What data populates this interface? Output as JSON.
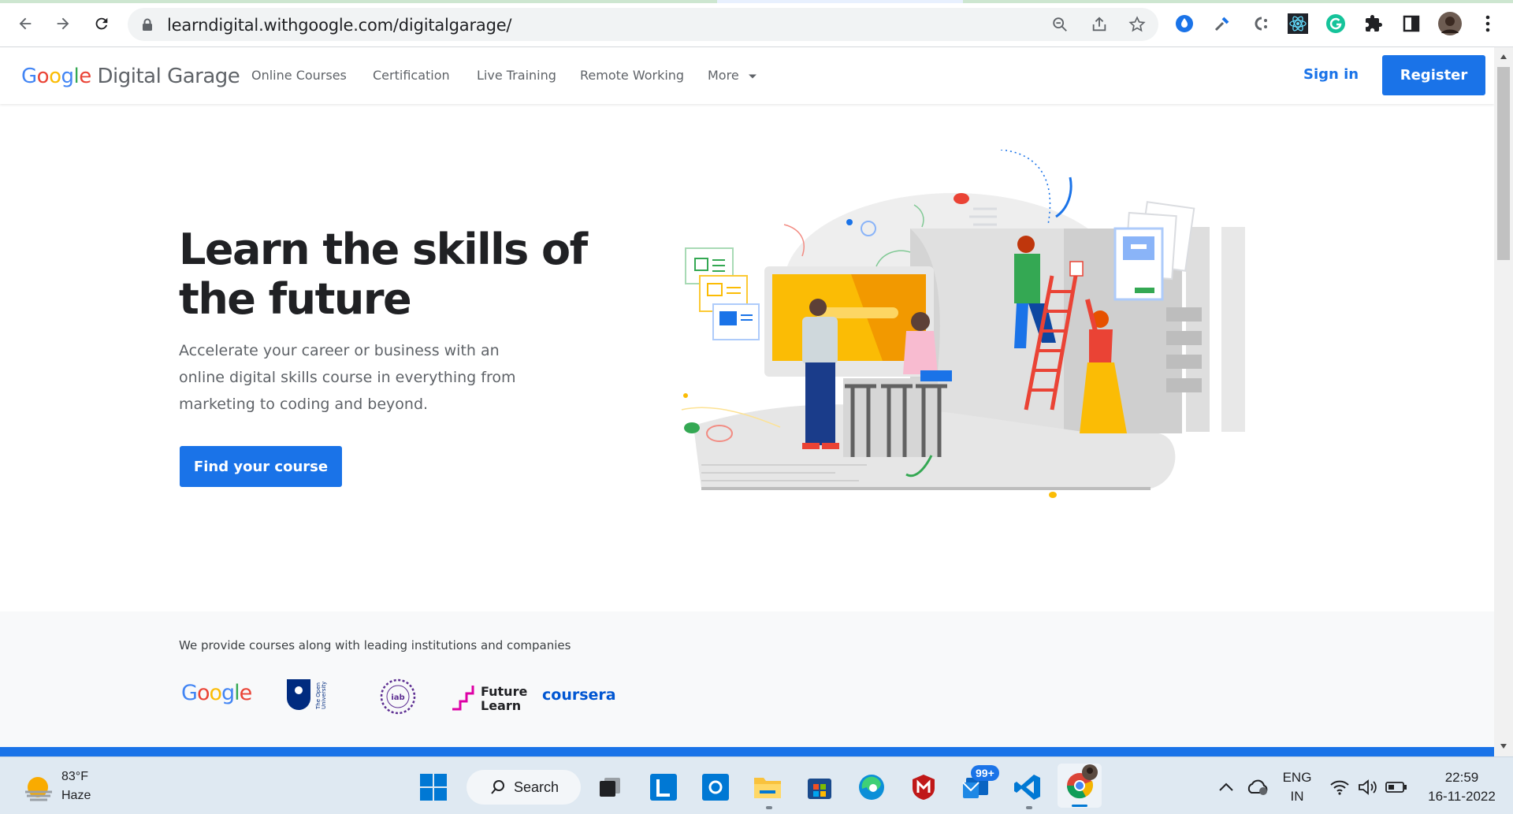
{
  "browser": {
    "url": "learndigital.withgoogle.com/digitalgarage/"
  },
  "header": {
    "logo_google": [
      "G",
      "o",
      "o",
      "g",
      "l",
      "e"
    ],
    "logo_text": "Digital Garage",
    "nav": [
      {
        "label": "Online Courses"
      },
      {
        "label": "Certification"
      },
      {
        "label": "Live Training"
      },
      {
        "label": "Remote Working"
      },
      {
        "label": "More"
      }
    ],
    "sign_in": "Sign in",
    "register": "Register"
  },
  "hero": {
    "title": "Learn the skills of the future",
    "subtitle": "Accelerate your career or business with an online digital skills course in everything from marketing to coding and beyond.",
    "cta": "Find your course"
  },
  "partners": {
    "text": "We provide courses along with leading institutions and companies",
    "logos": [
      "Google",
      "The Open University",
      "iab",
      "Future Learn",
      "coursera"
    ]
  },
  "taskbar": {
    "weather_temp": "83°F",
    "weather_desc": "Haze",
    "search_label": "Search",
    "mail_badge": "99+",
    "lang_top": "ENG",
    "lang_bottom": "IN",
    "time": "22:59",
    "date": "16-11-2022"
  },
  "colors": {
    "accent": "#1a73e8",
    "google_blue": "#4285f4",
    "google_red": "#ea4335",
    "google_yellow": "#fbbc05",
    "google_green": "#34a853"
  }
}
